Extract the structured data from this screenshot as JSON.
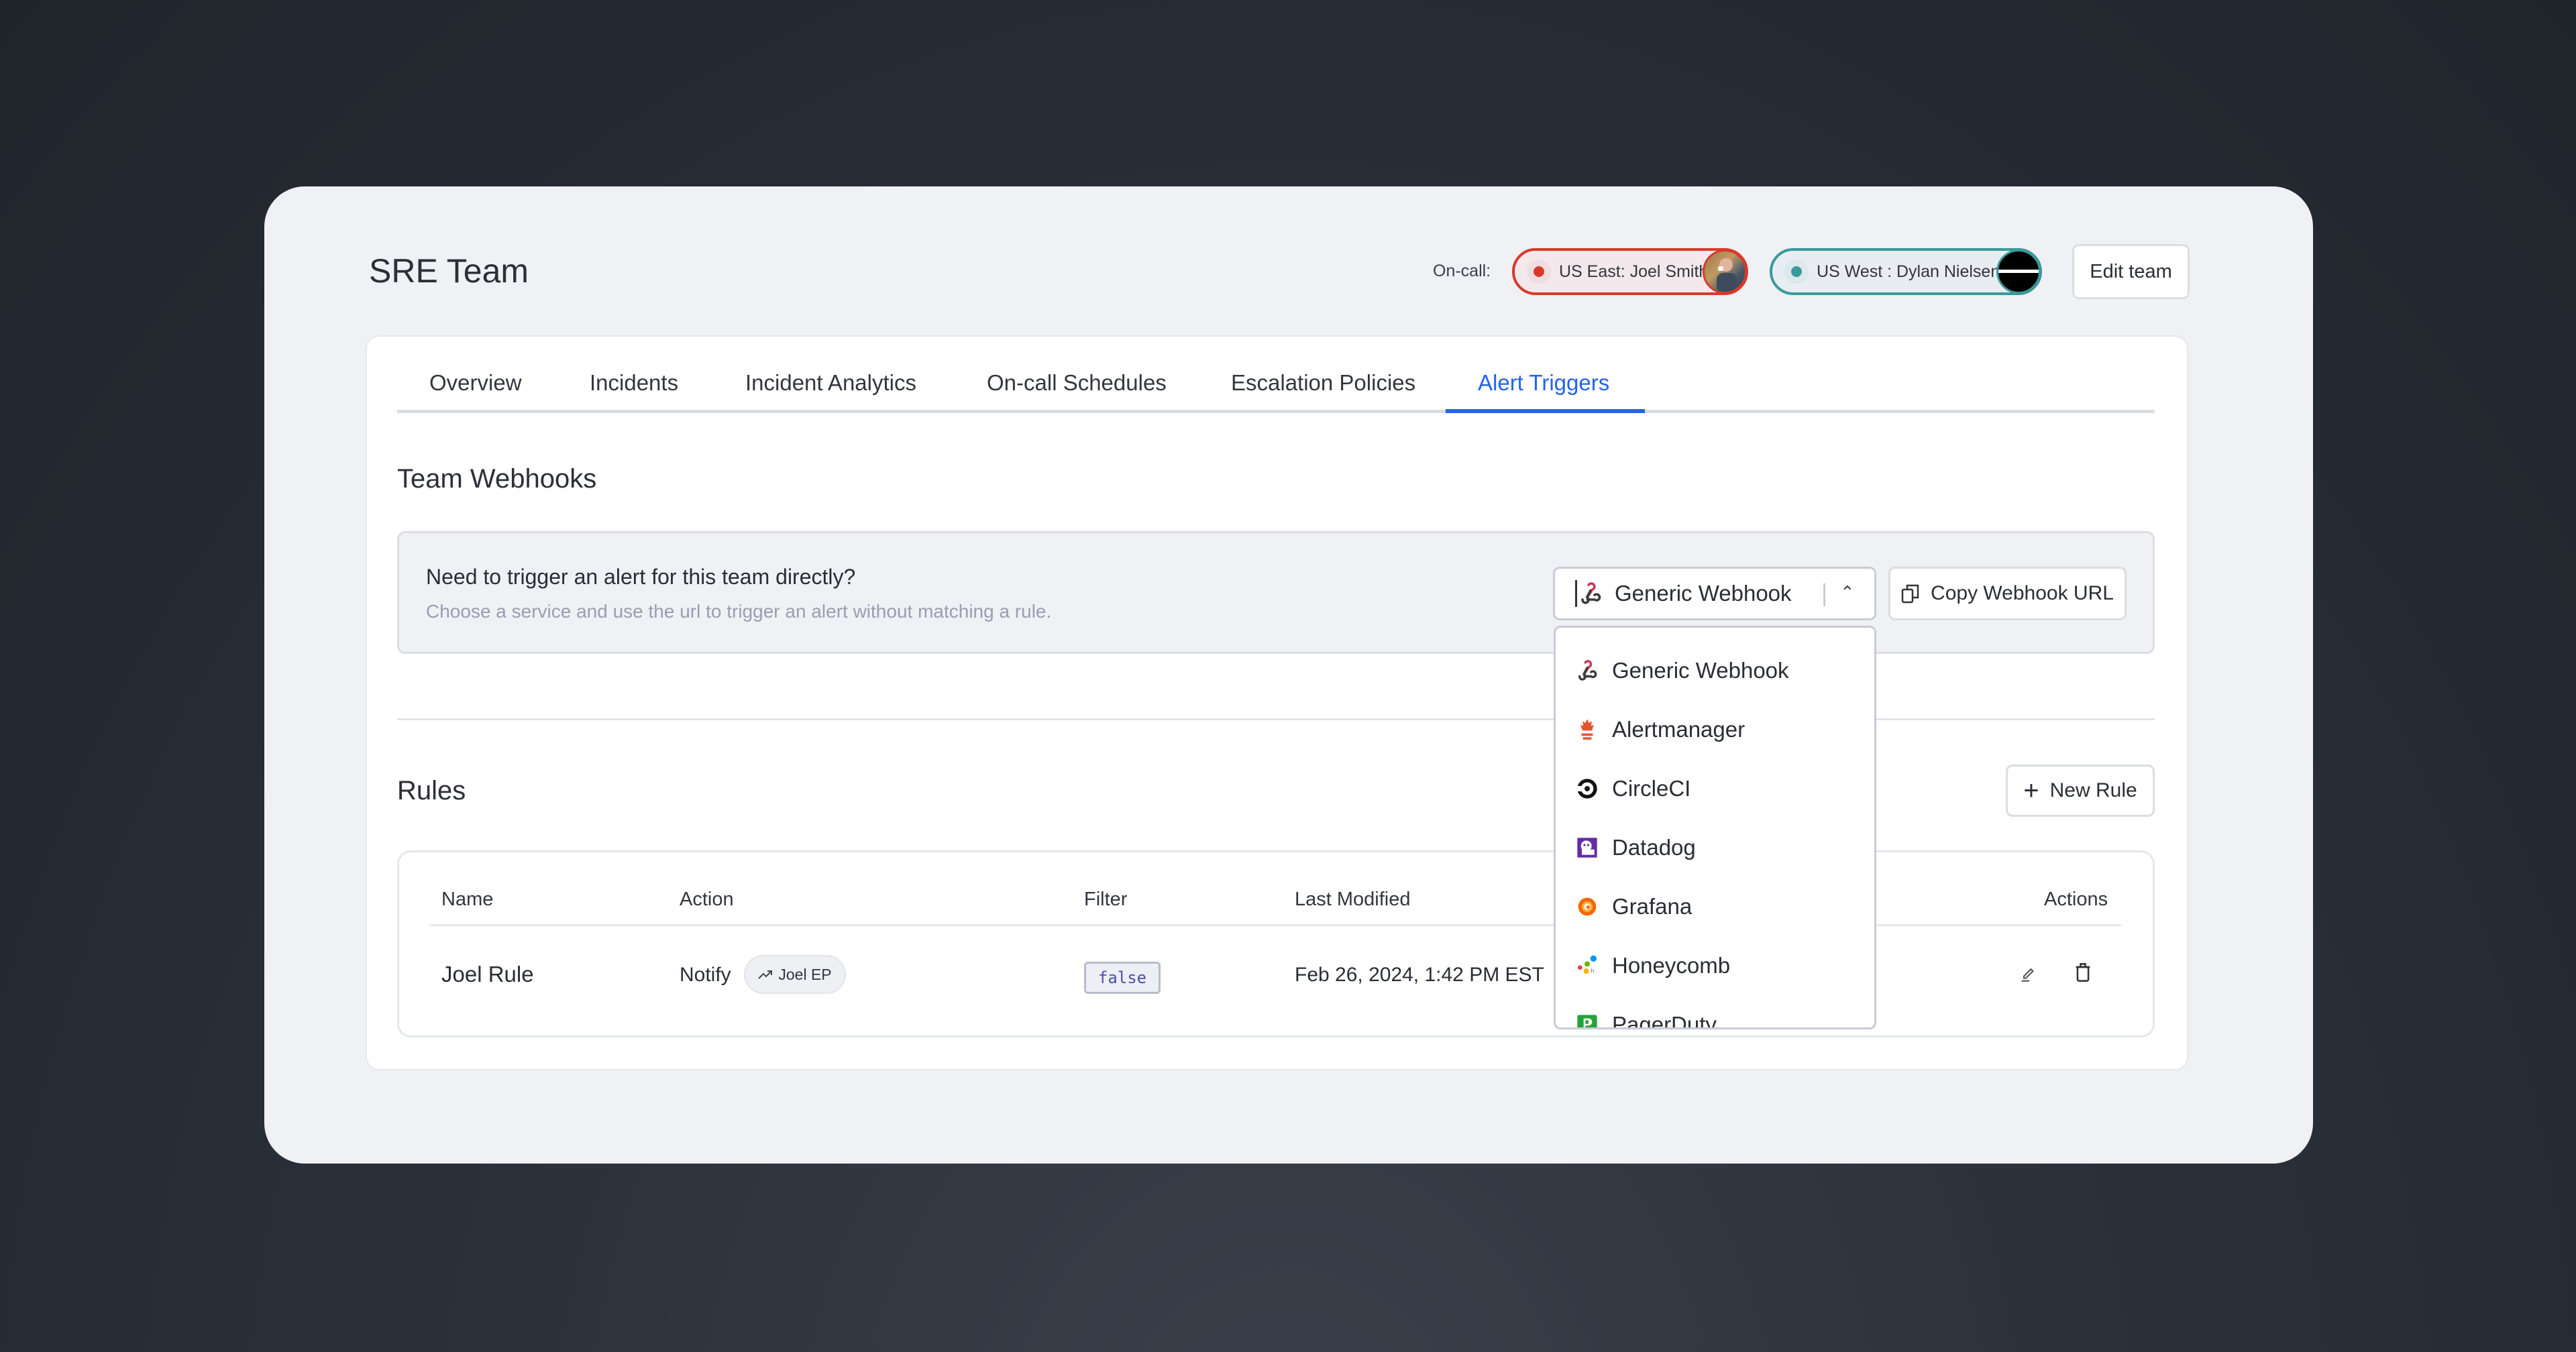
{
  "header": {
    "title": "SRE Team",
    "oncall_label": "On-call:",
    "oncall": [
      {
        "label": "US East: Joel Smith",
        "status_color": "#d83a2a"
      },
      {
        "label": "US West : Dylan Nielsen",
        "status_color": "#3a9a9a"
      }
    ],
    "edit_team_label": "Edit team"
  },
  "tabs": [
    {
      "label": "Overview",
      "active": false
    },
    {
      "label": "Incidents",
      "active": false
    },
    {
      "label": "Incident Analytics",
      "active": false
    },
    {
      "label": "On-call Schedules",
      "active": false
    },
    {
      "label": "Escalation Policies",
      "active": false
    },
    {
      "label": "Alert Triggers",
      "active": true
    }
  ],
  "webhooks": {
    "heading": "Team Webhooks",
    "prompt_title": "Need to trigger an alert for this team directly?",
    "prompt_subtitle": "Choose a service and use the url to trigger an alert without matching a rule.",
    "selected_service": "Generic Webhook",
    "copy_button_label": "Copy Webhook URL",
    "service_options": [
      {
        "label": "Generic Webhook",
        "icon": "webhook-icon"
      },
      {
        "label": "Alertmanager",
        "icon": "alertmanager-icon"
      },
      {
        "label": "CircleCI",
        "icon": "circleci-icon"
      },
      {
        "label": "Datadog",
        "icon": "datadog-icon"
      },
      {
        "label": "Grafana",
        "icon": "grafana-icon"
      },
      {
        "label": "Honeycomb",
        "icon": "honeycomb-icon"
      },
      {
        "label": "PagerDuty",
        "icon": "pagerduty-icon"
      }
    ]
  },
  "rules": {
    "heading": "Rules",
    "new_rule_label": "New Rule",
    "columns": {
      "name": "Name",
      "action": "Action",
      "filter": "Filter",
      "last_modified": "Last Modified",
      "actions": "Actions"
    },
    "rows": [
      {
        "name": "Joel Rule",
        "action": "Notify",
        "target": "Joel EP",
        "filter": "false",
        "last_modified": "Feb 26, 2024, 1:42 PM EST"
      }
    ]
  },
  "colors": {
    "accent": "#2563eb",
    "background": "#f0f1f5"
  }
}
